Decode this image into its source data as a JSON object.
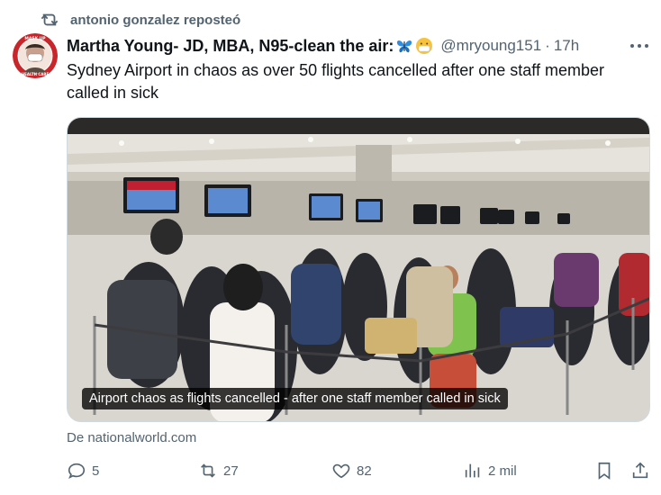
{
  "repost": {
    "icon": "repost-icon",
    "text": "antonio gonzalez reposteó"
  },
  "author": {
    "avatar": "avatar-image",
    "name": "Martha Young- JD, MBA, N95-clean the air:",
    "emoji_1": "butterfly-emoji",
    "emoji_2": "mask-face-emoji",
    "handle": "@mryoung151",
    "separator": "·",
    "time": "17h"
  },
  "tweet": {
    "text": "Sydney Airport in chaos as over 50 flights cancelled after one staff member called in sick"
  },
  "card": {
    "image": "airport-check-in-queue-photo",
    "caption": "Airport chaos as flights cancelled - after one staff member called in sick",
    "source": "De nationalworld.com"
  },
  "actions": {
    "reply": {
      "icon": "reply-icon",
      "count": "5"
    },
    "retweet": {
      "icon": "retweet-icon",
      "count": "27"
    },
    "like": {
      "icon": "heart-icon",
      "count": "82"
    },
    "views": {
      "icon": "views-icon",
      "count": "2 mil"
    },
    "bookmark": {
      "icon": "bookmark-icon"
    },
    "share": {
      "icon": "share-icon"
    }
  },
  "colors": {
    "muted": "#536471",
    "text": "#0f1419",
    "border": "#cfd9de"
  }
}
